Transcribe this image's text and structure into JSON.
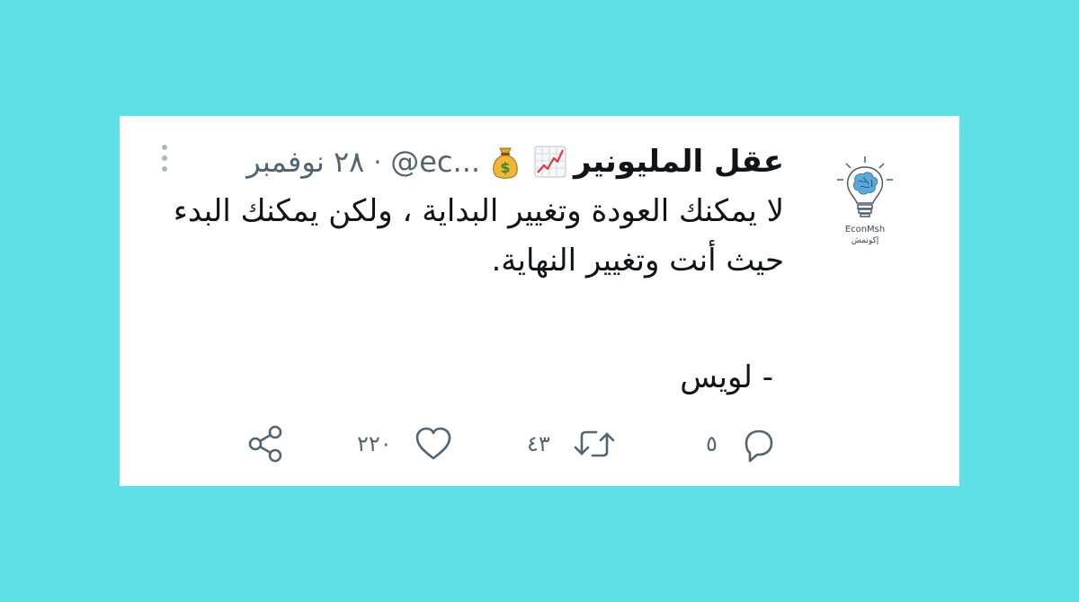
{
  "tweet": {
    "display_name": "عقل المليونير",
    "handle": "@ec...",
    "separator": "·",
    "date": "٢٨ نوفمبر",
    "text": "لا يمكنك العودة وتغيير البداية ، ولكن يمكنك البدء حيث أنت وتغيير النهاية.",
    "signature": "- لويس",
    "avatar": {
      "name": "EconMsh",
      "subtitle": "إكونمش",
      "icon": "lightbulb-brain-icon"
    },
    "emojis": [
      "chart-increasing-icon",
      "money-bag-icon"
    ]
  },
  "actions": {
    "reply_count": "٥",
    "retweet_count": "٤٣",
    "like_count": "٢٢٠"
  },
  "colors": {
    "background": "#5de1e6",
    "card": "#ffffff",
    "text": "#0f1419",
    "muted": "#536471"
  }
}
